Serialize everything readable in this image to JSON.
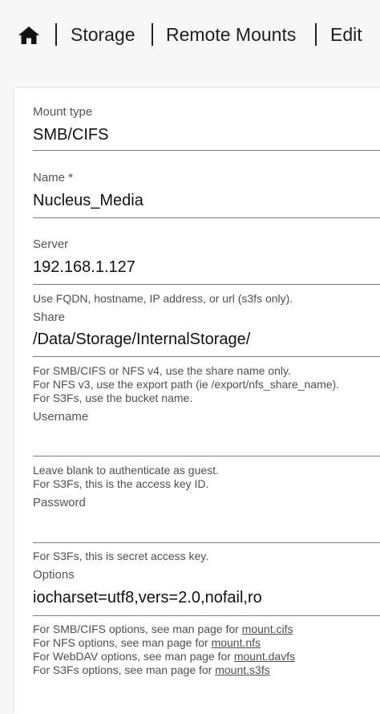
{
  "breadcrumb": {
    "home_icon": "home-icon",
    "items": [
      "Storage",
      "Remote Mounts",
      "Edit"
    ]
  },
  "form": {
    "mount_type": {
      "label": "Mount type",
      "value": "SMB/CIFS"
    },
    "name": {
      "label": "Name *",
      "value": "Nucleus_Media"
    },
    "server": {
      "label": "Server",
      "value": "192.168.1.127",
      "help": "Use FQDN, hostname, IP address, or url (s3fs only)."
    },
    "share": {
      "label": "Share",
      "value": "/Data/Storage/InternalStorage/",
      "help": [
        "For SMB/CIFS or NFS v4, use the share name only.",
        "For NFS v3, use the export path (ie /export/nfs_share_name).",
        "For S3Fs, use the bucket name."
      ]
    },
    "username": {
      "label": "Username",
      "value": "",
      "help": [
        "Leave blank to authenticate as guest.",
        "For S3Fs, this is the access key ID."
      ]
    },
    "password": {
      "label": "Password",
      "value": "",
      "help": "For S3Fs, this is secret access key."
    },
    "options": {
      "label": "Options",
      "value": "iocharset=utf8,vers=2.0,nofail,ro",
      "help": [
        {
          "text": "For SMB/CIFS options, see man page for ",
          "link": "mount.cifs"
        },
        {
          "text": "For NFS options, see man page for ",
          "link": "mount.nfs"
        },
        {
          "text": "For WebDAV options, see man page for ",
          "link": "mount.davfs"
        },
        {
          "text": "For S3Fs options, see man page for ",
          "link": "mount.s3fs"
        }
      ]
    }
  }
}
